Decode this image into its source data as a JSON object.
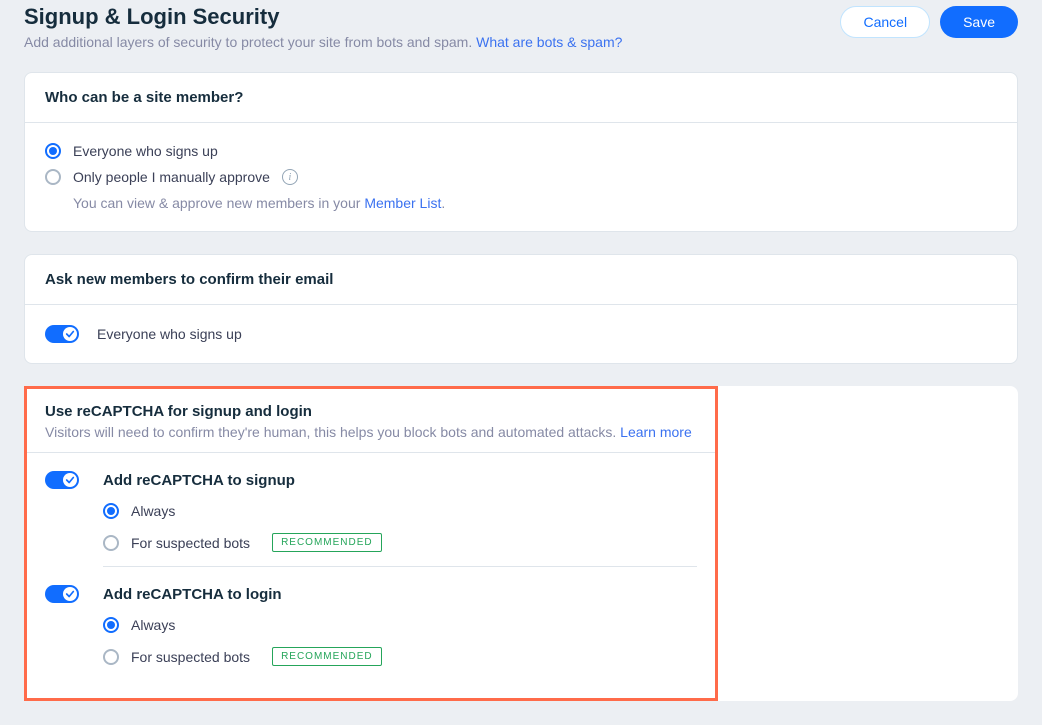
{
  "header": {
    "title": "Signup & Login Security",
    "subtitle": "Add additional layers of security to protect your site from bots and spam.",
    "link_text": "What are bots & spam?",
    "cancel_label": "Cancel",
    "save_label": "Save"
  },
  "membership": {
    "title": "Who can be a site member?",
    "option_everyone": "Everyone who signs up",
    "option_manual": "Only people I manually approve",
    "manual_sub_prefix": "You can view & approve new members in your ",
    "manual_sub_link": "Member List",
    "manual_sub_suffix": "."
  },
  "email_confirm": {
    "title": "Ask new members to confirm their email",
    "toggle_label": "Everyone who signs up"
  },
  "recaptcha": {
    "title": "Use reCAPTCHA for signup and login",
    "desc": "Visitors will need to confirm they're human, this helps you block bots and automated attacks.",
    "learn_more": "Learn more",
    "signup": {
      "heading": "Add reCAPTCHA to signup",
      "option_always": "Always",
      "option_suspected": "For suspected bots",
      "badge": "RECOMMENDED"
    },
    "login": {
      "heading": "Add reCAPTCHA to login",
      "option_always": "Always",
      "option_suspected": "For suspected bots",
      "badge": "RECOMMENDED"
    }
  }
}
